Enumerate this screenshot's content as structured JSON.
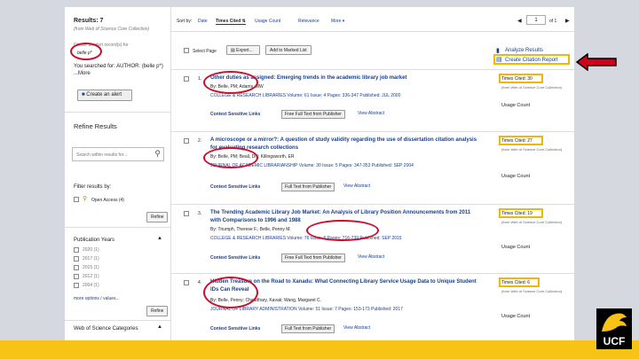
{
  "sidebar": {
    "results_label": "Results: 7",
    "results_source": "(from Web of Science Core Collection)",
    "alert_line": "Create an alert record(s) for",
    "alert_value": "belle p*",
    "searched_for": "You searched for: AUTHOR: (belle p*) ...More",
    "create_alert": "Create an alert",
    "refine_heading": "Refine Results",
    "search_placeholder": "Search within results for...",
    "filter_label": "Filter results by:",
    "open_access": "Open Access (4)",
    "refine_btn": "Refine",
    "pub_years_heading": "Publication Years",
    "years": [
      "2020 (1)",
      "2017 (1)",
      "2015 (1)",
      "2012 (1)",
      "2004 (1)"
    ],
    "more_options": "more options / values...",
    "refine_btn2": "Refine",
    "wos_categories": "Web of Science Categories"
  },
  "sortbar": {
    "sort_by": "Sort by:",
    "date": "Date",
    "times_cited": "Times Cited",
    "usage_count": "Usage Count",
    "relevance": "Relevance",
    "more": "More",
    "page_current": "1",
    "page_of": "of 1"
  },
  "toolbar": {
    "select_page": "Select Page",
    "export": "Export...",
    "add_marked": "Add to Marked List",
    "analyze": "Analyze Results",
    "citation_report": "Create Citation Report"
  },
  "records": [
    {
      "num": "1.",
      "title": "Other duties as assigned: Emerging trends in the academic library job market",
      "authors": "By: Belle, PM; Adams, MW",
      "journal": "COLLEGE & RESEARCH LIBRARIES Volume: 61 Issue: 4 Pages: 336-347 Published: JUL 2000",
      "times_cited": "Times Cited: 30",
      "tc_sub": "(from Web of Science Core Collection)",
      "usage": "Usage Count",
      "fulltext": "Free Full Text from Publisher",
      "context": "Context Sensitive Links",
      "view_abstract": "View Abstract"
    },
    {
      "num": "2.",
      "title": "A microscope or a mirror?: A question of study validity regarding the use of dissertation citation analysis",
      "title2": "for evaluating research collections",
      "authors": "By: Belle, PM; Beall, DN; Killingsworth, ER",
      "journal": "JOURNAL OF ACADEMIC LIBRARIANSHIP Volume: 30 Issue: 5 Pages: 347-353 Published: SEP 2004",
      "times_cited": "Times Cited: 27",
      "tc_sub": "(from Web of Science Core Collection)",
      "usage": "Usage Count",
      "fulltext": "Full Text from Publisher",
      "context": "Context Sensitive Links",
      "view_abstract": "View Abstract"
    },
    {
      "num": "3.",
      "title": "The Trending Academic Library Job Market: An Analysis of Library Position Announcements from 2011",
      "title2": "with Comparisons to 1996 and 1988",
      "authors": "By: Triumph, Therese F.; Belle, Penny M.",
      "journal": "COLLEGE & RESEARCH LIBRARIES Volume: 76 Issue: 6 Pages: 716-739 Published: SEP 2015",
      "times_cited": "Times Cited: 19",
      "tc_sub": "(from Web of Science Core Collection)",
      "usage": "Usage Count",
      "fulltext": "Free Full Text from Publisher",
      "context": "Context Sensitive Links",
      "view_abstract": "View Abstract"
    },
    {
      "num": "4.",
      "title": "Hidden Treasure on the Road to Xanadu: What Connecting Library Service Usage Data to Unique Student",
      "title2": "IDs Can Reveal",
      "authors": "By: Belle, Penny; Chaudhary, Kavak; Wang, Margaret C.",
      "journal": "JOURNAL OF LIBRARY ADMINISTRATION Volume: 51 Issue: 7 Pages: 153-173 Published: 2017",
      "times_cited": "Times Cited: 6",
      "tc_sub": "(from Web of Science Core Collection)",
      "usage": "Usage Count",
      "fulltext": "Full Text from Publisher",
      "context": "Context Sensitive Links",
      "view_abstract": "View Abstract"
    }
  ],
  "logo_text": "UCF",
  "colors": {
    "highlight_red": "#c8102e",
    "highlight_yellow": "#f2b705",
    "ucf_gold": "#f7c315"
  }
}
